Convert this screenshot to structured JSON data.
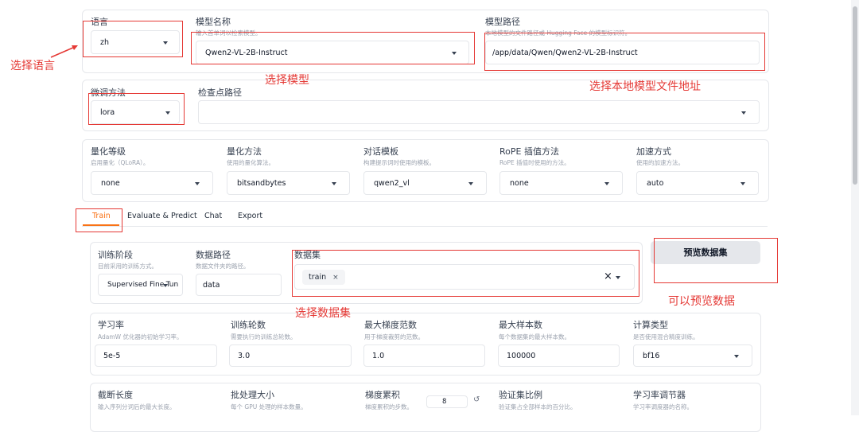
{
  "lang": {
    "label": "语言",
    "value": "zh"
  },
  "model_name": {
    "label": "模型名称",
    "info": "输入首单词以检索模型。",
    "value": "Qwen2-VL-2B-Instruct"
  },
  "model_path": {
    "label": "模型路径",
    "info": "本地模型的文件路径或 Hugging Face 的模型标识符。",
    "value": "/app/data/Qwen/Qwen2-VL-2B-Instruct"
  },
  "finetune": {
    "label": "微调方法",
    "value": "lora"
  },
  "checkpoint": {
    "label": "检查点路径",
    "value": ""
  },
  "quant_bit": {
    "label": "量化等级",
    "info": "启用量化（QLoRA）。",
    "value": "none"
  },
  "quant_method": {
    "label": "量化方法",
    "info": "使用的量化算法。",
    "value": "bitsandbytes"
  },
  "template": {
    "label": "对话模板",
    "info": "构建提示词时使用的模板。",
    "value": "qwen2_vl"
  },
  "rope": {
    "label": "RoPE 插值方法",
    "info": "RoPE 插值时使用的方法。",
    "value": "none"
  },
  "booster": {
    "label": "加速方式",
    "info": "使用的加速方法。",
    "value": "auto"
  },
  "tabs": [
    "Train",
    "Evaluate & Predict",
    "Chat",
    "Export"
  ],
  "stage": {
    "label": "训练阶段",
    "info": "目前采用的训练方式。",
    "value": "Supervised Fine-Tun"
  },
  "dataset_dir": {
    "label": "数据路径",
    "info": "数据文件夹的路径。",
    "value": "data"
  },
  "dataset": {
    "label": "数据集",
    "chip": "train",
    "chip_x": "×",
    "clear": "×"
  },
  "preview_button": "预览数据集",
  "lr": {
    "label": "学习率",
    "info": "AdamW 优化器的初始学习率。",
    "value": "5e-5"
  },
  "epochs": {
    "label": "训练轮数",
    "info": "需要执行的训练总轮数。",
    "value": "3.0"
  },
  "max_grad": {
    "label": "最大梯度范数",
    "info": "用于梯度裁剪的范数。",
    "value": "1.0"
  },
  "max_samples": {
    "label": "最大样本数",
    "info": "每个数据集的最大样本数。",
    "value": "100000"
  },
  "compute_type": {
    "label": "计算类型",
    "info": "是否使用混合精度训练。",
    "value": "bf16"
  },
  "cutoff": {
    "label": "截断长度",
    "info": "输入序列分词后的最大长度。"
  },
  "batch": {
    "label": "批处理大小",
    "info": "每个 GPU 处理的样本数量。"
  },
  "grad_accum": {
    "label": "梯度累积",
    "info": "梯度累积的步数。",
    "value": "8",
    "reset": "↺"
  },
  "val_size": {
    "label": "验证集比例",
    "info": "验证集占全部样本的百分比。"
  },
  "scheduler": {
    "label": "学习率调节器",
    "info": "学习率调度器的名称。"
  },
  "annotations": {
    "lang": "选择语言",
    "model": "选择模型",
    "path": "选择本地模型文件地址",
    "dataset": "选择数据集",
    "preview": "可以预览数据"
  },
  "colors": {
    "annotation": "#e53935",
    "accent": "#f97316"
  }
}
